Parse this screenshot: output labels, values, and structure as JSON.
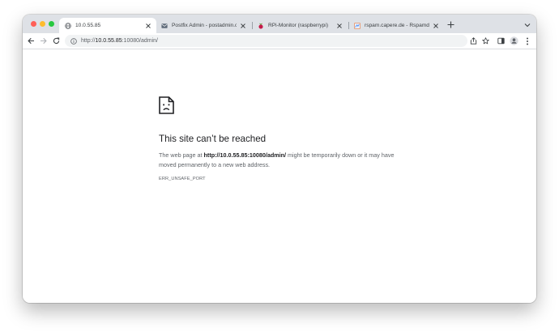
{
  "browser": {
    "tabs": [
      {
        "title": "10.0.55.85",
        "favicon": "globe-icon",
        "active": true
      },
      {
        "title": "Postfix Admin - postadmin.ca",
        "favicon": "postfix-admin-favicon",
        "active": false
      },
      {
        "title": "RPi-Monitor (raspberrypi)",
        "favicon": "raspberry-pi-favicon",
        "active": false
      },
      {
        "title": "rspam.capere.de - Rspamd We",
        "favicon": "rspamd-favicon",
        "active": false
      }
    ],
    "address_bar": {
      "scheme": "http://",
      "host": "10.0.55.85",
      "path": ":10080/admin/"
    }
  },
  "error_page": {
    "heading": "This site can’t be reached",
    "body_prefix": "The web page at ",
    "body_url": "http://10.0.55.85:10080/admin/",
    "body_suffix": " might be temporarily down or it may have moved permanently to a new web address.",
    "error_code": "ERR_UNSAFE_PORT",
    "icon": "sad-document-icon"
  },
  "colors": {
    "tabstrip": "#dee1e6",
    "omnibox": "#f1f3f4",
    "heading_text": "#202124",
    "body_text": "#5f6368",
    "close_red": "#ff5f57",
    "minimize_yellow": "#febc2e",
    "zoom_green": "#28c840"
  }
}
